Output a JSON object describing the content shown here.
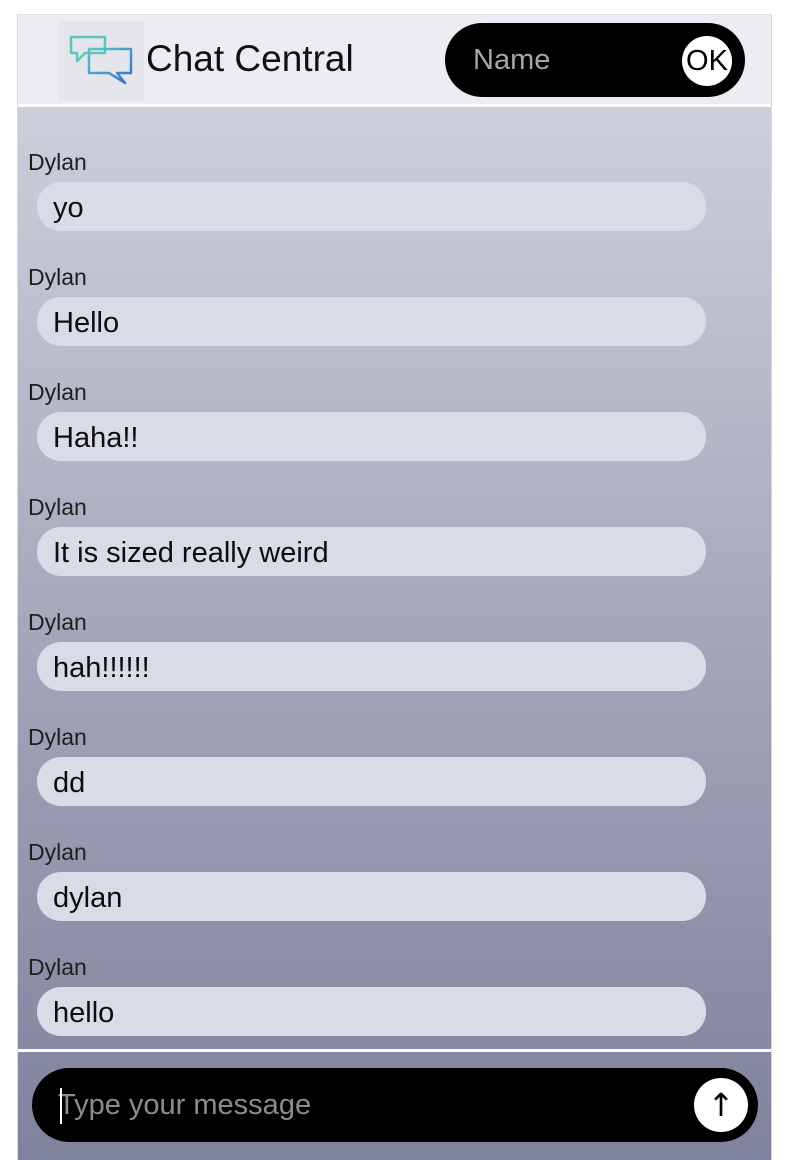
{
  "header": {
    "title": "Chat Central",
    "logo_icon": "chat-bubbles-icon",
    "name_input": {
      "placeholder": "Name",
      "value": ""
    },
    "ok_label": "OK"
  },
  "messages": [
    {
      "sender": "Dylan",
      "text": "yo"
    },
    {
      "sender": "Dylan",
      "text": "Hello"
    },
    {
      "sender": "Dylan",
      "text": "Haha!!"
    },
    {
      "sender": "Dylan",
      "text": "It is sized really weird"
    },
    {
      "sender": "Dylan",
      "text": "hah!!!!!!"
    },
    {
      "sender": "Dylan",
      "text": "dd"
    },
    {
      "sender": "Dylan",
      "text": "dylan"
    },
    {
      "sender": "Dylan",
      "text": "hello"
    }
  ],
  "composer": {
    "placeholder": "Type your message",
    "value": "",
    "send_icon": "arrow-up-icon",
    "send_glyph": "↑"
  },
  "colors": {
    "accent_teal": "#4fb8b8",
    "accent_blue": "#3a7bd5",
    "pill_black": "#000000",
    "bubble_bg": "#d9dce7",
    "header_bg": "#ebedf2"
  }
}
